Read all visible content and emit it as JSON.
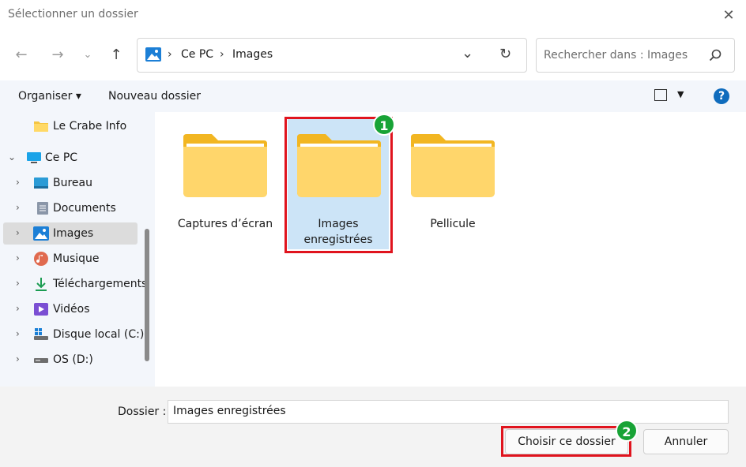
{
  "window": {
    "title": "Sélectionner un dossier"
  },
  "address": {
    "segments": [
      "Ce PC",
      "Images"
    ]
  },
  "search": {
    "placeholder": "Rechercher dans : Images"
  },
  "toolbar": {
    "organize_label": "Organiser",
    "new_folder_label": "Nouveau dossier",
    "help_label": "?"
  },
  "sidebar": {
    "items": [
      {
        "label": "Le Crabe Info",
        "icon": "folder-icon",
        "level": 1
      },
      {
        "label": "Ce PC",
        "icon": "computer-icon",
        "level": 0,
        "expanded": true
      },
      {
        "label": "Bureau",
        "icon": "desktop-icon",
        "level": 1
      },
      {
        "label": "Documents",
        "icon": "documents-icon",
        "level": 1
      },
      {
        "label": "Images",
        "icon": "pictures-icon",
        "level": 1,
        "selected": true
      },
      {
        "label": "Musique",
        "icon": "music-icon",
        "level": 1
      },
      {
        "label": "Téléchargements",
        "icon": "download-icon",
        "level": 1
      },
      {
        "label": "Vidéos",
        "icon": "videos-icon",
        "level": 1
      },
      {
        "label": "Disque local (C:)",
        "icon": "drive-icon",
        "level": 1
      },
      {
        "label": "OS (D:)",
        "icon": "drive-icon",
        "level": 1
      }
    ]
  },
  "content": {
    "folders": [
      {
        "label": "Captures d’écran",
        "selected": false
      },
      {
        "label_line1": "Images",
        "label_line2": "enregistrées",
        "selected": true
      },
      {
        "label": "Pellicule",
        "selected": false
      }
    ]
  },
  "annotations": {
    "badge1": "1",
    "badge2": "2"
  },
  "footer": {
    "folder_label": "Dossier :",
    "folder_value": "Images enregistrées",
    "choose_button": "Choisir ce dossier",
    "cancel_button": "Annuler"
  },
  "colors": {
    "accent": "#0f6cbd",
    "highlight": "#e0141e",
    "badge": "#18a336",
    "selection": "#cce4f7"
  }
}
